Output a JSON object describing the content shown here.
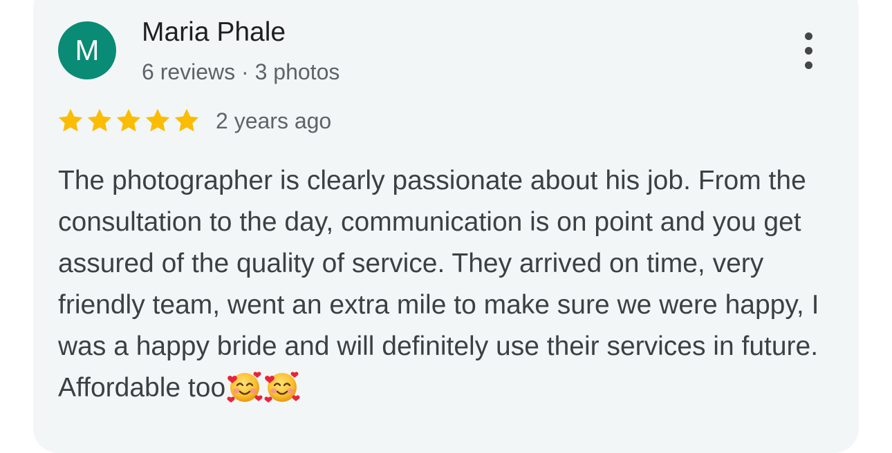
{
  "review": {
    "avatar_letter": "M",
    "author_name": "Maria Phale",
    "author_meta": "6 reviews · 3 photos",
    "rating": 5,
    "rating_max": 5,
    "date": "2 years ago",
    "text": "The photographer is clearly passionate about his job. From the consultation to the day, communication is on point and you get assured of the quality of service. They arrived on time, very friendly team, went an extra mile to make sure we were happy, I was a happy bride and will definitely use their services in future. Affordable too",
    "emojis": [
      "smiling-face-with-hearts",
      "smiling-face-with-hearts"
    ]
  },
  "colors": {
    "card_background": "#f2f6f7",
    "avatar_background": "#098b75",
    "star": "#fbbc04",
    "primary_text": "#1f1f1f",
    "secondary_text": "#5f6368"
  },
  "icons": {
    "more": "more-vert-icon",
    "star": "star-icon",
    "emoji": "smiling-face-with-hearts-icon"
  }
}
